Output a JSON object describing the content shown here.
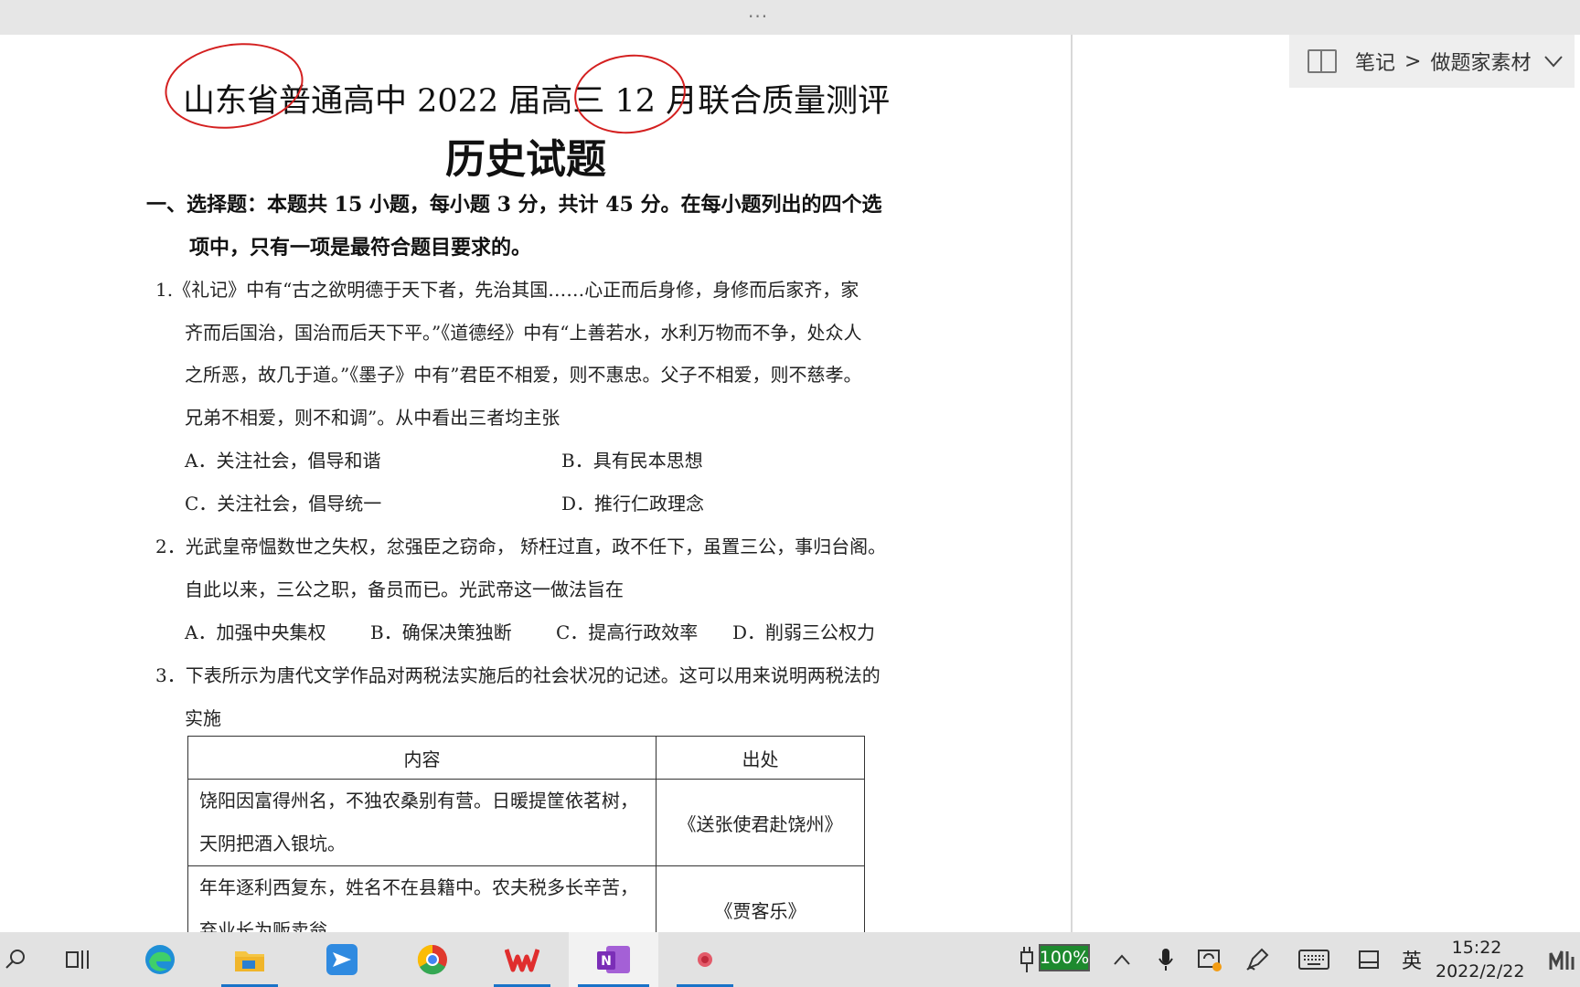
{
  "window": {
    "grip": "···"
  },
  "notebook": {
    "path_prefix": "笔记",
    "separator": ">",
    "section": "做题家素材"
  },
  "document": {
    "title": "山东省普通高中 2022 届高三 12 月联合质量测评",
    "subtitle": "历史试题",
    "section_line1": "一、选择题：本题共 15 小题，每小题 3 分，共计 45 分。在每小题列出的四个选",
    "section_line2": "项中，只有一项是最符合题目要求的。",
    "q1": {
      "lines": [
        "1.《礼记》中有“古之欲明德于天下者，先治其国……心正而后身修，身修而后家齐，家",
        "齐而后国治，国治而后天下平。”《道德经》中有“上善若水，水利万物而不争，处众人",
        "之所恶，故几于道。”《墨子》中有”君臣不相爱，则不惠忠。父子不相爱，则不慈孝。",
        "兄弟不相爱，则不和调”。从中看出三者均主张"
      ],
      "options": [
        "A．关注社会，倡导和谐",
        "B．具有民本思想",
        "C．关注社会，倡导统一",
        "D．推行仁政理念"
      ]
    },
    "q2": {
      "lines": [
        "2．光武皇帝愠数世之失权，忿强臣之窃命，   矫枉过直，政不任下，虽置三公，事归台阁。",
        "自此以来，三公之职，备员而已。光武帝这一做法旨在"
      ],
      "options": [
        "A．加强中央集权",
        "B．确保决策独断",
        "C．提高行政效率",
        "D．削弱三公权力"
      ]
    },
    "q3": {
      "lines": [
        "3．下表所示为唐代文学作品对两税法实施后的社会状况的记述。这可以用来说明两税法的",
        "实施"
      ],
      "table": {
        "headers": [
          "内容",
          "出处"
        ],
        "rows": [
          {
            "content_lines": [
              "饶阳因富得州名，不独农桑别有营。日暖提筐依茗树，",
              "天阴把酒入银坑。"
            ],
            "source": "《送张使君赴饶州》"
          },
          {
            "content_lines": [
              "年年逐利西复东，姓名不在县籍中。农夫税多长辛苦，",
              "弃业长为贩卖翁。"
            ],
            "source": "《贾客乐》"
          }
        ]
      }
    }
  },
  "taskbar": {
    "battery": "100%",
    "ime": "英",
    "time": "15:22",
    "date": "2022/2/22",
    "colors": {
      "battery": "#1d8a2e",
      "accent": "#1a73c8",
      "annotation": "#d42020"
    }
  }
}
